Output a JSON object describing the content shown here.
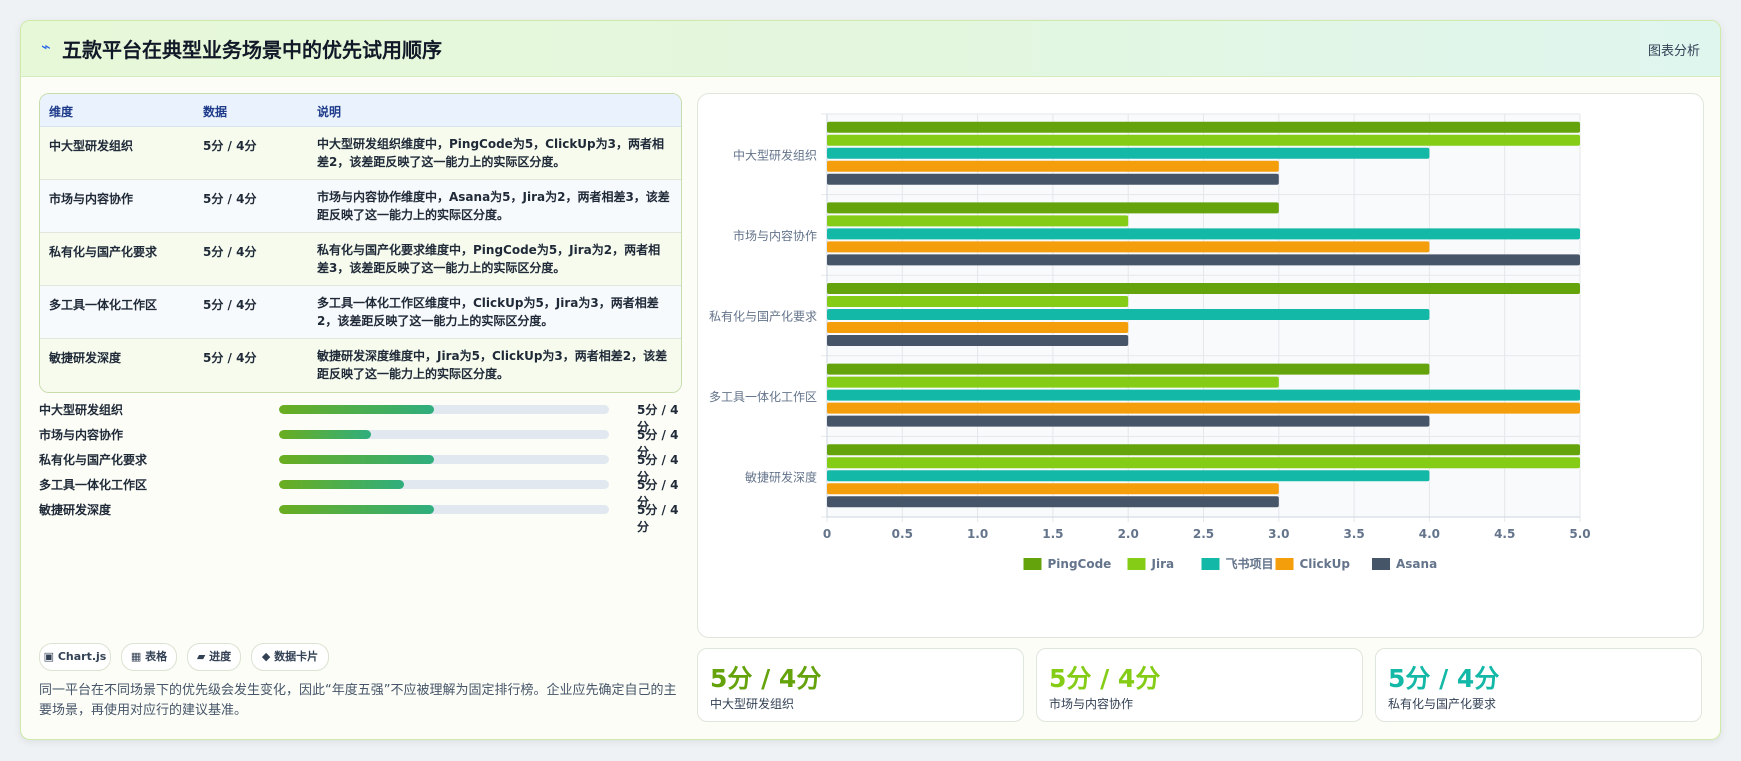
{
  "header": {
    "icon": "bolt-icon",
    "title": "五款平台在典型业务场景中的优先试用顺序",
    "link": "图表分析"
  },
  "table": {
    "headers": [
      "维度",
      "数据",
      "说明"
    ],
    "rows": [
      {
        "dim": "中大型研发组织",
        "val": "5分 / 4分",
        "desc": "中大型研发组织维度中，PingCode为5，ClickUp为3，两者相差2，该差距反映了这一能力上的实际区分度。"
      },
      {
        "dim": "市场与内容协作",
        "val": "5分 / 4分",
        "desc": "市场与内容协作维度中，Asana为5，Jira为2，两者相差3，该差距反映了这一能力上的实际区分度。"
      },
      {
        "dim": "私有化与国产化要求",
        "val": "5分 / 4分",
        "desc": "私有化与国产化要求维度中，PingCode为5，Jira为2，两者相差3，该差距反映了这一能力上的实际区分度。"
      },
      {
        "dim": "多工具一体化工作区",
        "val": "5分 / 4分",
        "desc": "多工具一体化工作区维度中，ClickUp为5，Jira为3，两者相差2，该差距反映了这一能力上的实际区分度。"
      },
      {
        "dim": "敏捷研发深度",
        "val": "5分 / 4分",
        "desc": "敏捷研发深度维度中，Jira为5，ClickUp为3，两者相差2，该差距反映了这一能力上的实际区分度。"
      }
    ]
  },
  "progress": [
    {
      "label": "中大型研发组织",
      "value": "5分 / 4分",
      "fraction": 0.47
    },
    {
      "label": "市场与内容协作",
      "value": "5分 / 4分",
      "fraction": 0.28
    },
    {
      "label": "私有化与国产化要求",
      "value": "5分 / 4分",
      "fraction": 0.47
    },
    {
      "label": "多工具一体化工作区",
      "value": "5分 / 4分",
      "fraction": 0.38
    },
    {
      "label": "敏捷研发深度",
      "value": "5分 / 4分",
      "fraction": 0.47
    }
  ],
  "chips": [
    "▣ Chart.js",
    "▦ 表格",
    "▰ 进度",
    "◆ 数据卡片"
  ],
  "note": "同一平台在不同场景下的优先级会发生变化，因此“年度五强”不应被理解为固定排行榜。企业应先确定自己的主要场景，再使用对应行的建议基准。",
  "stats": [
    {
      "value": "5分 / 4分",
      "label": "中大型研发组织",
      "color": "#65a30d"
    },
    {
      "value": "5分 / 4分",
      "label": "市场与内容协作",
      "color": "#84cc16"
    },
    {
      "value": "5分 / 4分",
      "label": "私有化与国产化要求",
      "color": "#14b8a6"
    }
  ],
  "chart_data": {
    "type": "bar",
    "orientation": "horizontal",
    "categories": [
      "中大型研发组织",
      "市场与内容协作",
      "私有化与国产化要求",
      "多工具一体化工作区",
      "敏捷研发深度"
    ],
    "series": [
      {
        "name": "PingCode",
        "color": "#65a30d",
        "values": [
          5,
          3,
          5,
          4,
          5
        ]
      },
      {
        "name": "Jira",
        "color": "#84cc16",
        "values": [
          5,
          2,
          2,
          3,
          5
        ]
      },
      {
        "name": "飞书项目",
        "color": "#14b8a6",
        "values": [
          4,
          5,
          4,
          5,
          4
        ]
      },
      {
        "name": "ClickUp",
        "color": "#f59e0b",
        "values": [
          3,
          4,
          2,
          5,
          3
        ]
      },
      {
        "name": "Asana",
        "color": "#475569",
        "values": [
          3,
          5,
          2,
          4,
          3
        ]
      }
    ],
    "xlim": [
      0,
      5
    ],
    "xticks": [
      "0",
      "0.5",
      "1.0",
      "1.5",
      "2.0",
      "2.5",
      "3.0",
      "3.5",
      "4.0",
      "4.5",
      "5.0"
    ],
    "grid": true,
    "legend": "bottom"
  }
}
